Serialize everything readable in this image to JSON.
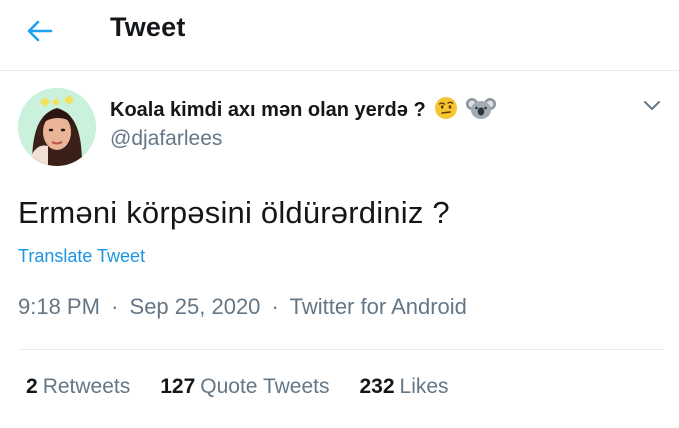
{
  "header": {
    "title": "Tweet",
    "back_icon": "arrow-left-icon",
    "accent_color": "#1da1f2"
  },
  "author": {
    "name": "Koala kimdi axı mən olan yerdə ?",
    "emojis": [
      "raised-eyebrow-face-emoji",
      "koala-emoji"
    ],
    "handle": "@djafarlees"
  },
  "menu_icon": "chevron-down-icon",
  "tweet": {
    "text": "Erməni körpəsini öldürərdiniz ?",
    "translate_label": "Translate Tweet",
    "time": "9:18 PM",
    "date": "Sep 25, 2020",
    "source": "Twitter for Android",
    "separator": "·"
  },
  "stats": [
    {
      "count": "2",
      "label": "Retweets"
    },
    {
      "count": "127",
      "label": "Quote Tweets"
    },
    {
      "count": "232",
      "label": "Likes"
    }
  ]
}
